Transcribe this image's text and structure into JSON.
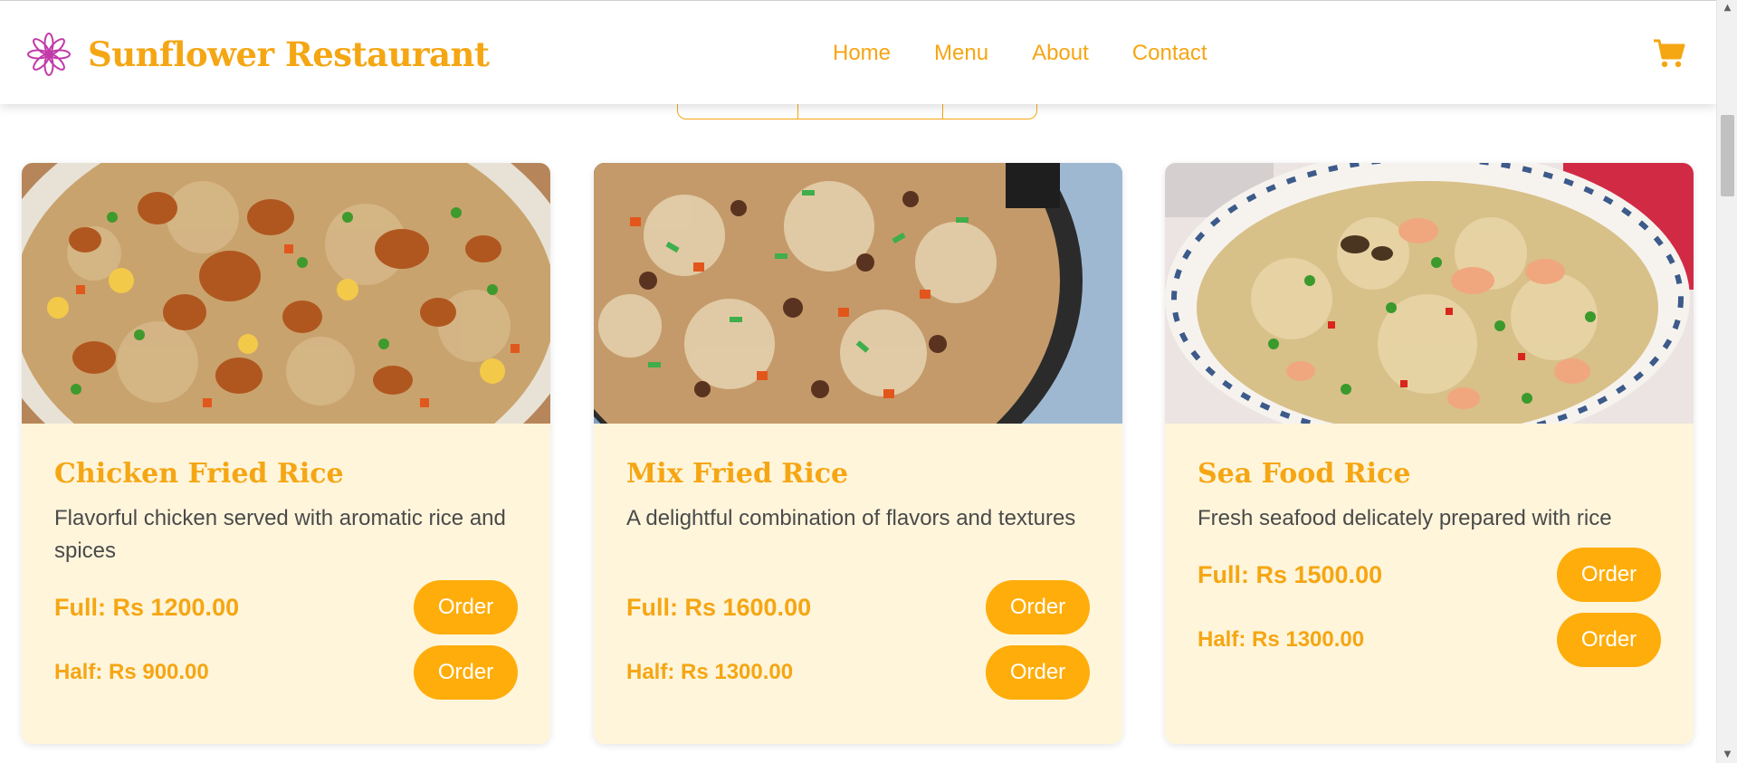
{
  "header": {
    "brand_name": "Sunflower Restaurant",
    "logo_icon": "sunflower-logo-icon",
    "nav": [
      "Home",
      "Menu",
      "About",
      "Contact"
    ],
    "cart_icon": "cart-icon"
  },
  "colors": {
    "accent": "#f5a613",
    "button": "#ffad0a",
    "card_bg": "#fff5db",
    "text": "#4a4a4a"
  },
  "cards": [
    {
      "title": "Chicken Fried Rice",
      "description": "Flavorful chicken served with aromatic rice and spices",
      "full_price": "Full: Rs 1200.00",
      "half_price": "Half: Rs 900.00",
      "order_label": "Order"
    },
    {
      "title": "Mix Fried Rice",
      "description": "A delightful combination of flavors and textures",
      "full_price": "Full: Rs 1600.00",
      "half_price": "Half: Rs 1300.00",
      "order_label": "Order"
    },
    {
      "title": "Sea Food Rice",
      "description": "Fresh seafood delicately prepared with rice",
      "full_price": "Full: Rs 1500.00",
      "half_price": "Half: Rs 1300.00",
      "order_label": "Order"
    }
  ]
}
